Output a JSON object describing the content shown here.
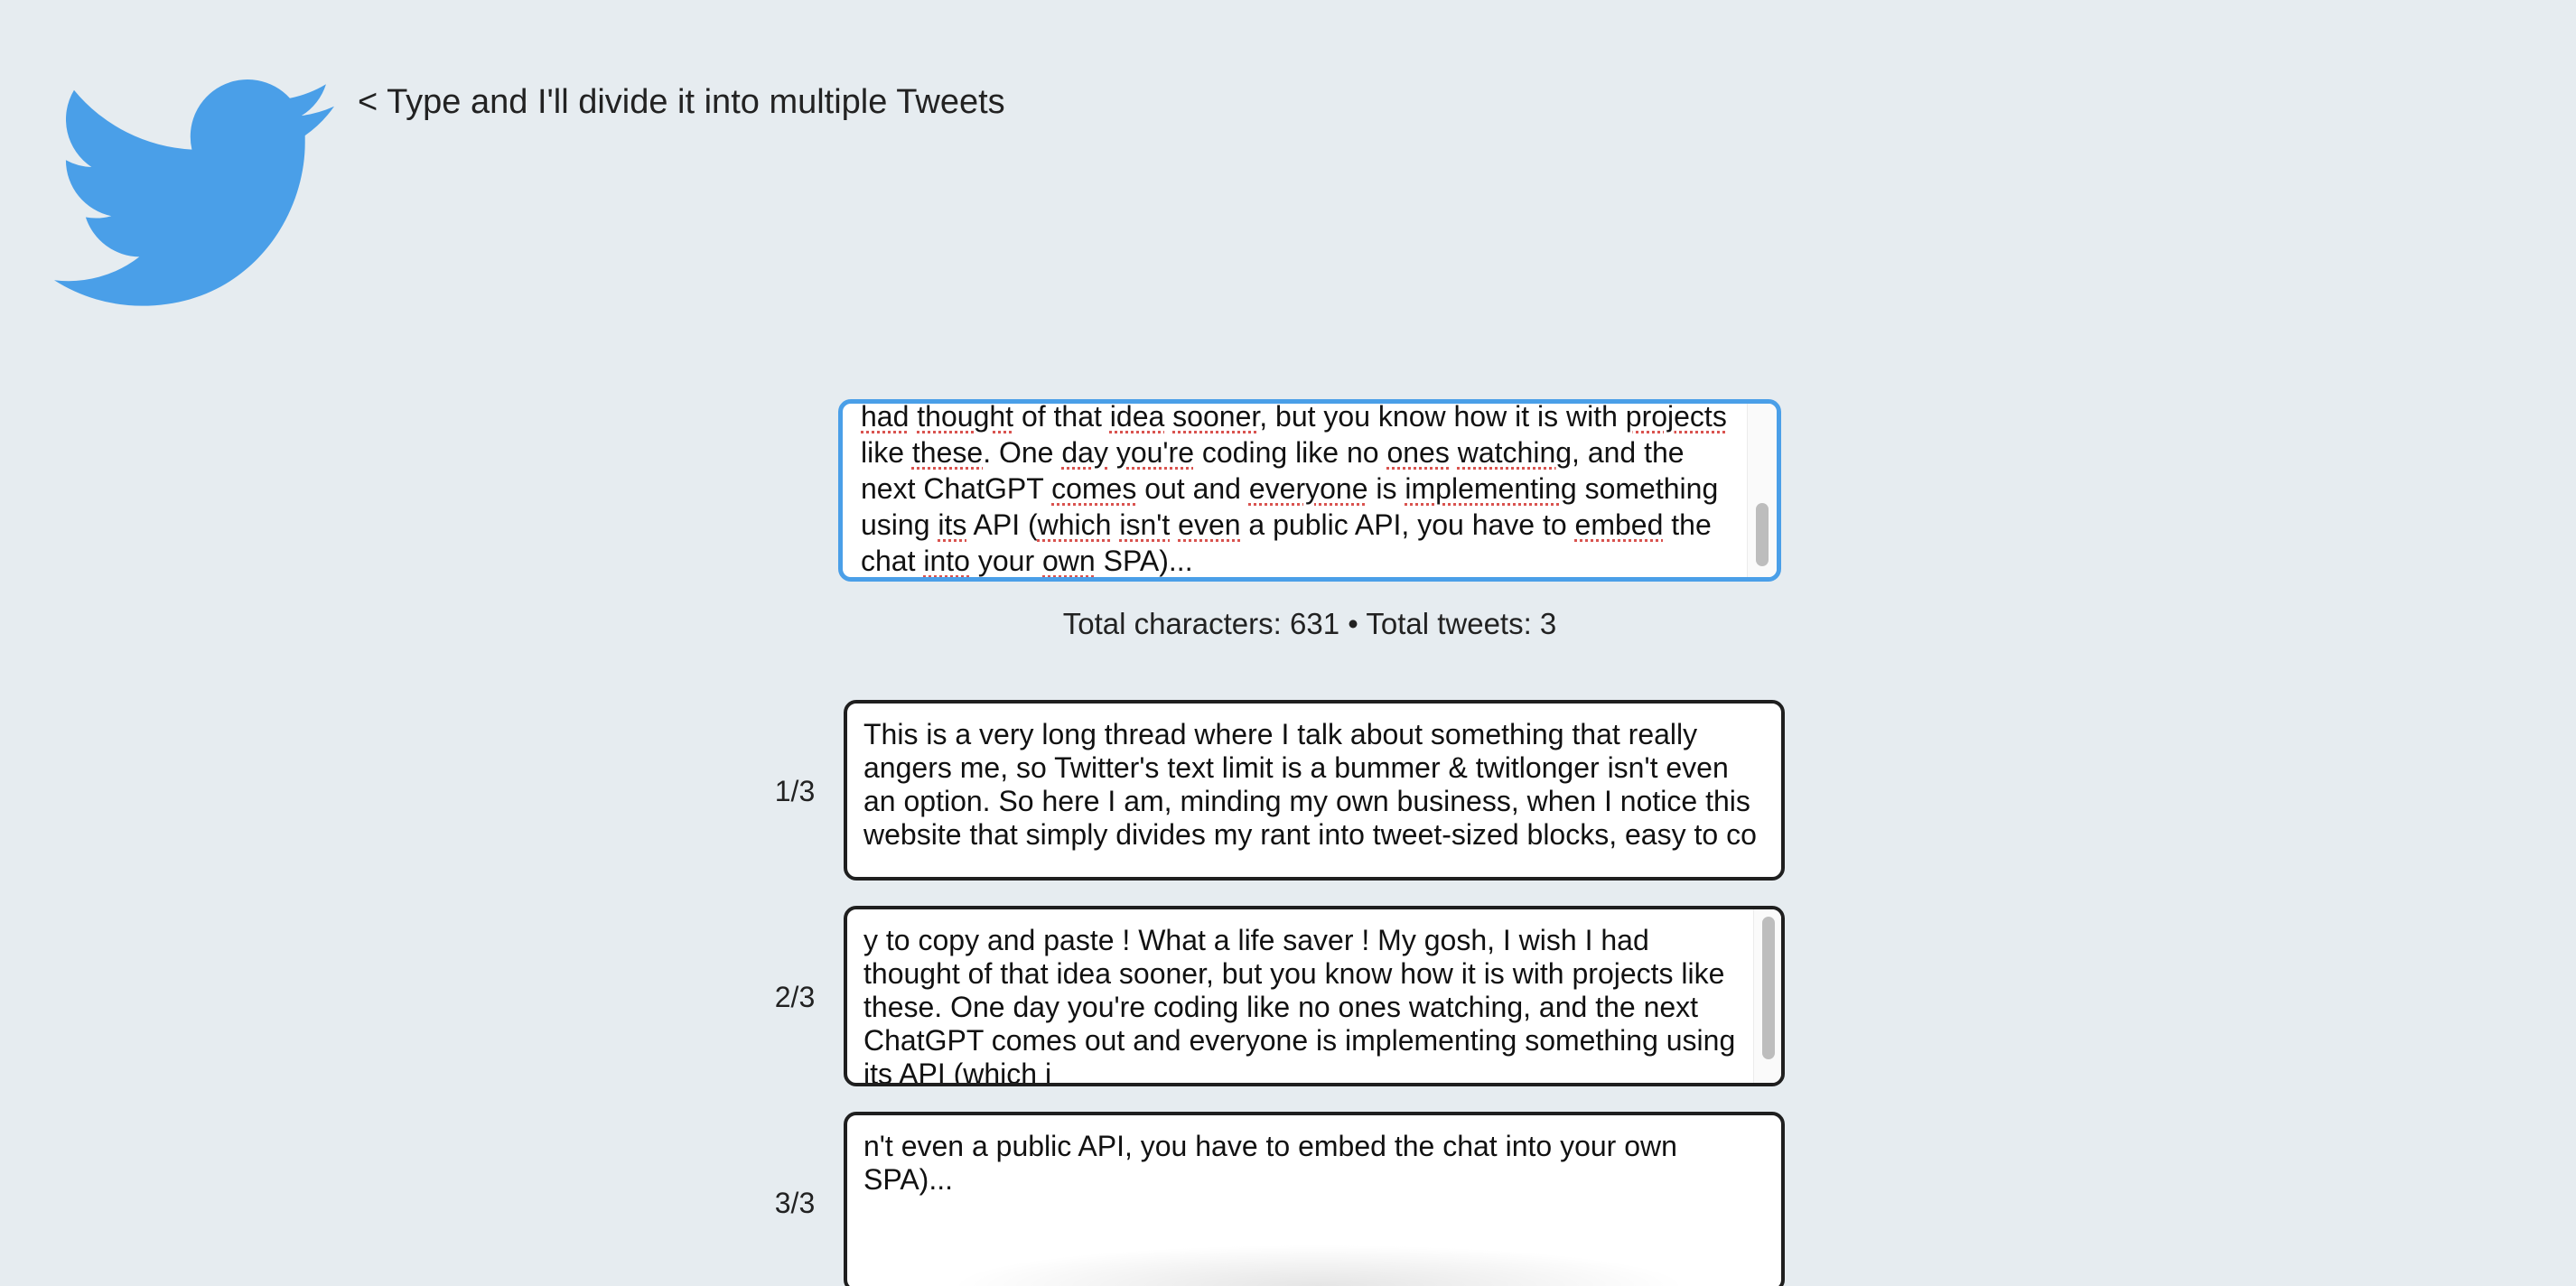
{
  "header": {
    "logo_icon": "twitter-bird-icon",
    "logo_color": "#4a9fe8",
    "tagline": "< Type and I'll divide it into multiple Tweets"
  },
  "composer": {
    "visible_lines": [
      "had thought of that idea sooner, but you know how it is with projects",
      "like these. One day you're coding like no ones watching, and the",
      "next ChatGPT comes out and everyone is implementing something",
      "using its API (which isn't even a public API, you have to embed the",
      "chat into your own SPA)..."
    ],
    "focus_color": "#4a9fe8"
  },
  "stats": {
    "text": "Total characters: 631 • Total tweets: 3"
  },
  "tweets": [
    {
      "number": "1/3",
      "lines": [
        "This is a very long thread where I talk about something that really",
        "angers me, so Twitter's text limit is a bummer & twitlonger isn't even",
        "an option. So here I am, minding my own business, when I notice this",
        "website that simply divides my rant into tweet-sized blocks, easy to co"
      ]
    },
    {
      "number": "2/3",
      "lines": [
        "y to copy and paste ! What a life saver ! My gosh, I wish I had",
        "thought of that idea sooner, but you know how it is with projects like",
        "these. One day you're coding like no ones watching, and the next",
        "ChatGPT comes out and everyone is implementing something using",
        "its API (which i"
      ]
    },
    {
      "number": "3/3",
      "lines": [
        "n't even a public API, you have to embed the chat into your own",
        "SPA)..."
      ]
    }
  ]
}
